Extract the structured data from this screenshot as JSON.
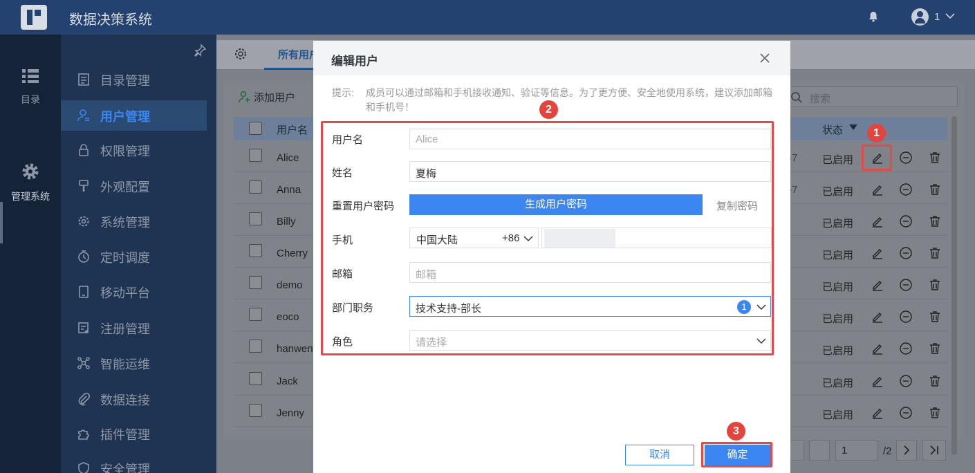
{
  "app": {
    "title": "数据决策系统",
    "user": "1"
  },
  "rail": {
    "items": [
      {
        "label": "目录"
      },
      {
        "label": "管理系统"
      }
    ]
  },
  "sidebar": {
    "items": [
      {
        "label": "目录管理"
      },
      {
        "label": "用户管理"
      },
      {
        "label": "权限管理"
      },
      {
        "label": "外观配置"
      },
      {
        "label": "系统管理"
      },
      {
        "label": "定时调度"
      },
      {
        "label": "移动平台"
      },
      {
        "label": "注册管理"
      },
      {
        "label": "智能运维"
      },
      {
        "label": "数据连接"
      },
      {
        "label": "插件管理"
      },
      {
        "label": "安全管理"
      }
    ],
    "active": "用户管理"
  },
  "tabs": {
    "active_label": "所有用户"
  },
  "toolbar": {
    "add_user": "添加用户",
    "search_placeholder": "搜索"
  },
  "table": {
    "columns": {
      "username": "用户名",
      "status": "状态"
    },
    "partial_text": "-7",
    "rows": [
      {
        "username": "Alice",
        "status": "已启用"
      },
      {
        "username": "Anna",
        "status": "已启用"
      },
      {
        "username": "Billy",
        "status": "已启用"
      },
      {
        "username": "Cherry",
        "status": "已启用"
      },
      {
        "username": "demo",
        "status": "已启用"
      },
      {
        "username": "eoco",
        "status": "已启用"
      },
      {
        "username": "hanwen",
        "status": "已启用"
      },
      {
        "username": "Jack",
        "status": "已启用"
      },
      {
        "username": "Jenny",
        "status": "已启用"
      }
    ]
  },
  "pager": {
    "page": "1",
    "total": "/2"
  },
  "modal": {
    "title": "编辑用户",
    "tip_label": "提示:",
    "tip_text": "成员可以通过邮箱和手机接收通知、验证等信息。为了更方便、安全地使用系统，建议添加邮箱和手机号！",
    "fields": {
      "username_label": "用户名",
      "username_value": "Alice",
      "name_label": "姓名",
      "name_value": "夏梅",
      "pwd_label": "重置用户密码",
      "gen_pwd": "生成用户密码",
      "copy_pwd": "复制密码",
      "phone_label": "手机",
      "country": "中国大陆",
      "country_code": "+86",
      "email_label": "邮箱",
      "email_placeholder": "邮箱",
      "dept_label": "部门职务",
      "dept_value": "技术支持-部长",
      "dept_count": "1",
      "role_label": "角色",
      "role_placeholder": "请选择"
    },
    "cancel": "取消",
    "ok": "确定"
  },
  "steps": [
    "1",
    "2",
    "3"
  ],
  "colors": {
    "primary": "#3b86f0",
    "header": "#23426f",
    "sidebar": "#1f3352",
    "annotation": "#e3443e"
  }
}
